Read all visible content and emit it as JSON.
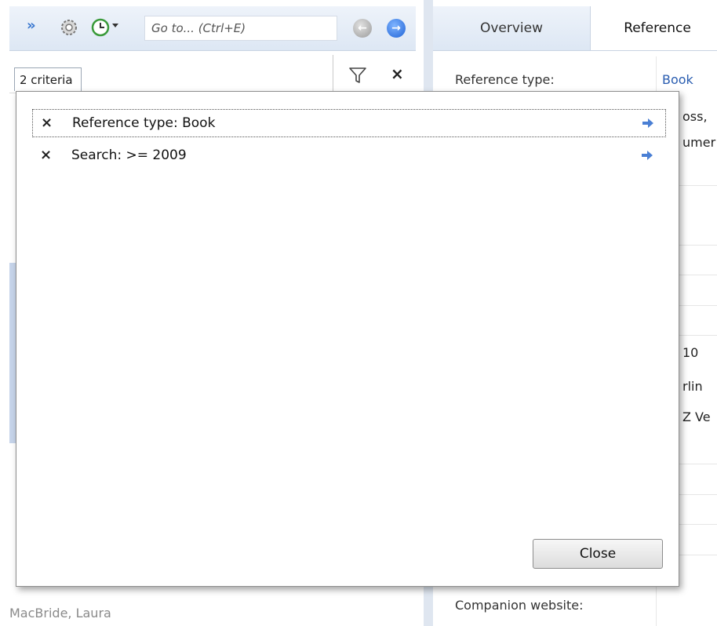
{
  "toolbar": {
    "expand_glyph": "»",
    "goto_placeholder": "Go to... (Ctrl+E)",
    "back_icon": "arrow-left-icon",
    "forward_icon": "arrow-right-icon"
  },
  "filter": {
    "criteria_tab": "2 criteria",
    "clear_glyph": "×"
  },
  "tabs": [
    {
      "label": "Overview"
    },
    {
      "label": "Reference"
    }
  ],
  "fields": {
    "reference_type_label": "Reference type:",
    "reference_type_value": "Book",
    "companion_label": "Companion website:"
  },
  "peek_texts": [
    "oss,",
    "umer",
    "10",
    "rlin",
    "Z Ve"
  ],
  "left_author": "MacBride, Laura",
  "popup": {
    "items": [
      {
        "remove_glyph": "×",
        "text": "Reference type: Book"
      },
      {
        "remove_glyph": "×",
        "text": "Search: >= 2009"
      }
    ],
    "close_label": "Close"
  },
  "colors": {
    "accent": "#2a5db0",
    "toolbar_bg": "#e4ecf6",
    "arrow_blue": "#3a78d0"
  }
}
